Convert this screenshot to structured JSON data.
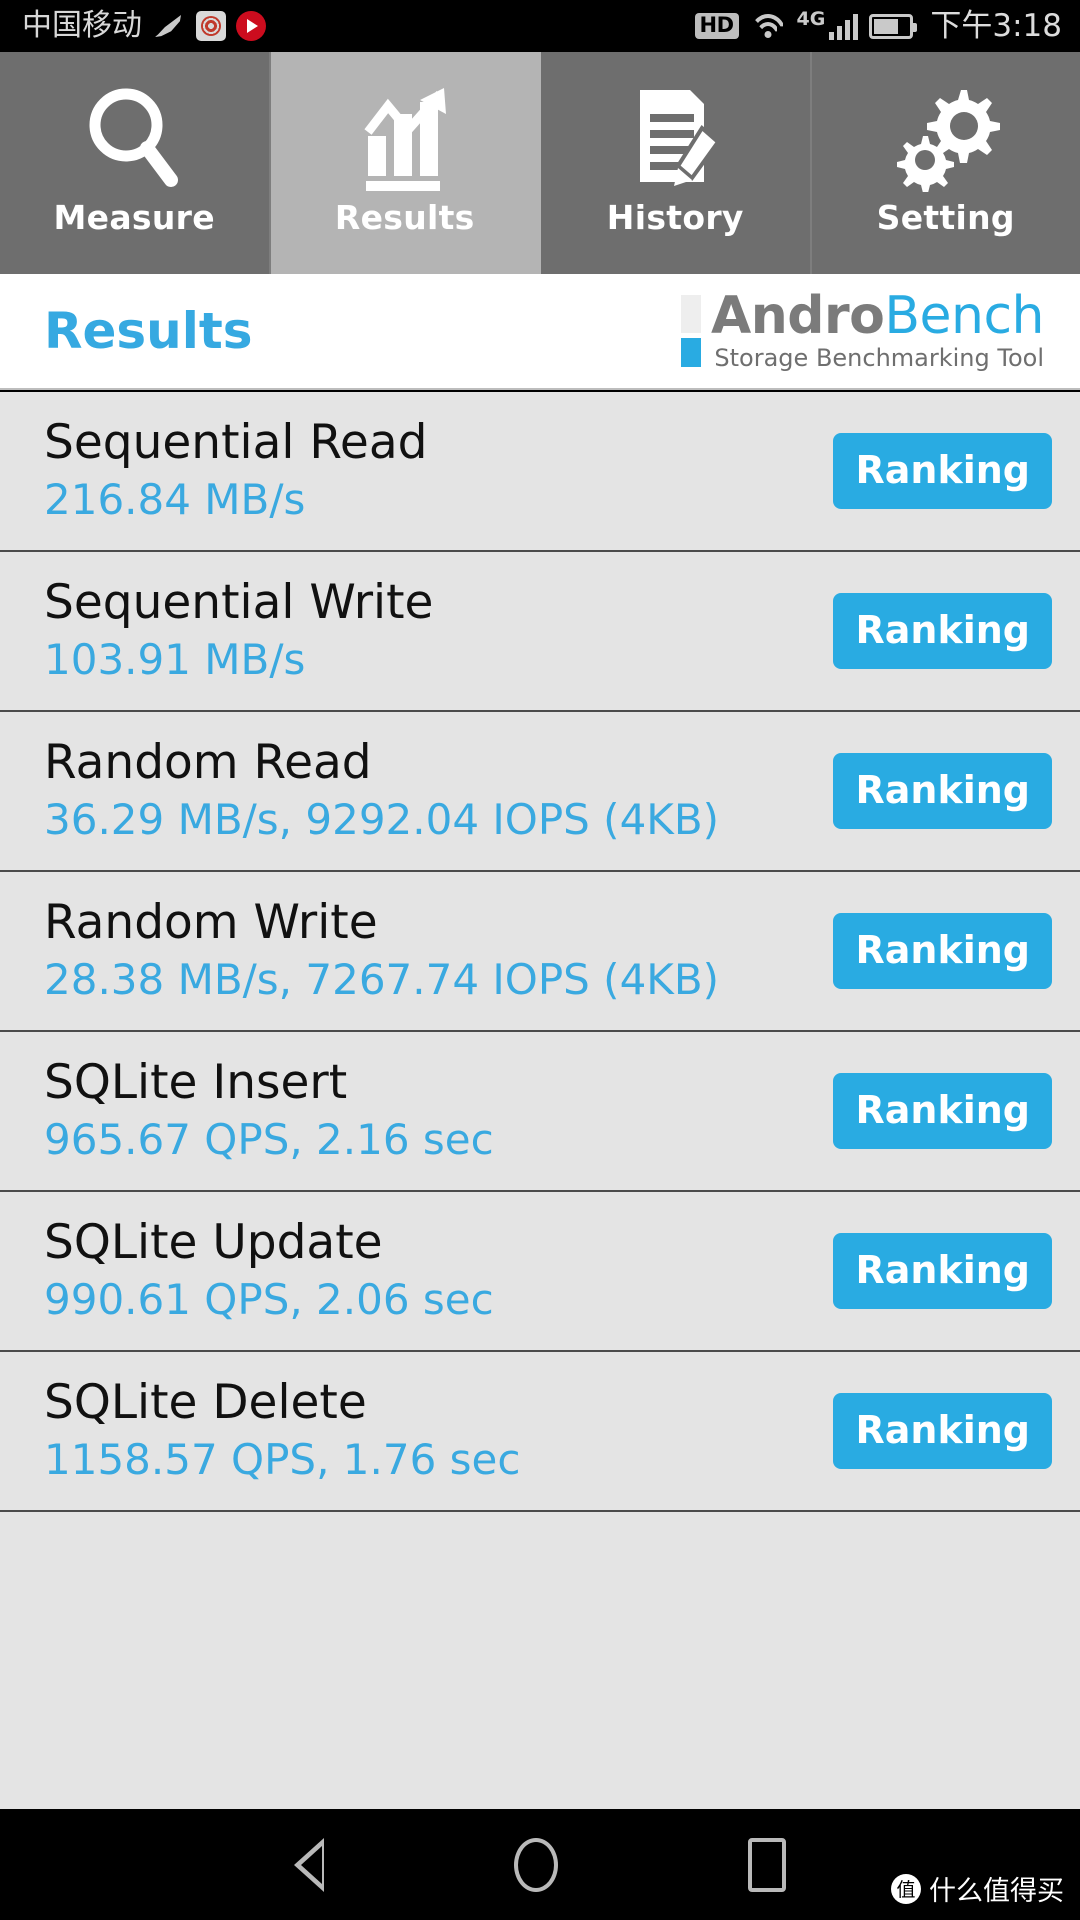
{
  "statusbar": {
    "carrier": "中国移动",
    "feather_icon": "feather-icon",
    "weibo_icon": "weibo-icon",
    "play_icon": "play-icon",
    "hd_badge": "HD",
    "wifi_icon": "wifi-icon",
    "network_type": "4G",
    "signal_icon": "signal-bars-icon",
    "battery_icon": "battery-icon",
    "time": "下午3:18"
  },
  "tabs": [
    {
      "label": "Measure",
      "icon": "magnifier-icon",
      "active": false
    },
    {
      "label": "Results",
      "icon": "bar-chart-icon",
      "active": true
    },
    {
      "label": "History",
      "icon": "document-pencil-icon",
      "active": false
    },
    {
      "label": "Setting",
      "icon": "gears-icon",
      "active": false
    }
  ],
  "header": {
    "title": "Results",
    "logo_andro": "Andro",
    "logo_bench": "Bench",
    "logo_subtitle": "Storage Benchmarking Tool"
  },
  "results": {
    "button_label": "Ranking",
    "rows": [
      {
        "title": "Sequential Read",
        "value": "216.84 MB/s"
      },
      {
        "title": "Sequential Write",
        "value": "103.91 MB/s"
      },
      {
        "title": "Random Read",
        "value": "36.29 MB/s, 9292.04 IOPS (4KB)"
      },
      {
        "title": "Random Write",
        "value": "28.38 MB/s, 7267.74 IOPS (4KB)"
      },
      {
        "title": "SQLite Insert",
        "value": "965.67 QPS, 2.16 sec"
      },
      {
        "title": "SQLite Update",
        "value": "990.61 QPS, 2.06 sec"
      },
      {
        "title": "SQLite Delete",
        "value": "1158.57 QPS, 1.76 sec"
      }
    ]
  },
  "navbar": {
    "back_icon": "back-triangle-icon",
    "home_icon": "home-circle-icon",
    "recent_icon": "recent-square-icon",
    "watermark_mark": "值",
    "watermark_text": "什么值得买"
  },
  "colors": {
    "accent": "#29abe2",
    "value_text": "#3aa9e0",
    "tab_bg": "#6e6e6e",
    "tab_active_bg": "#b4b4b4",
    "list_bg": "#e4e4e4"
  }
}
